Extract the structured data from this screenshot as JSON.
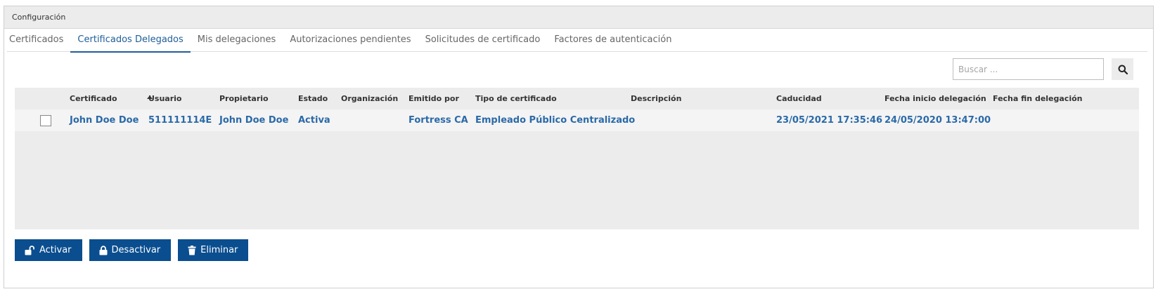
{
  "panel": {
    "title": "Configuración"
  },
  "tabs": [
    {
      "label": "Certificados",
      "active": false
    },
    {
      "label": "Certificados Delegados",
      "active": true
    },
    {
      "label": "Mis delegaciones",
      "active": false
    },
    {
      "label": "Autorizaciones pendientes",
      "active": false
    },
    {
      "label": "Solicitudes de certificado",
      "active": false
    },
    {
      "label": "Factores de autenticación",
      "active": false
    }
  ],
  "search": {
    "placeholder": "Buscar ...",
    "value": "",
    "icon": "search-icon"
  },
  "table": {
    "columns": [
      "Certificado",
      "Usuario",
      "Propietario",
      "Estado",
      "Organización",
      "Emitido por",
      "Tipo de certificado",
      "Descripción",
      "Caducidad",
      "Fecha inicio delegación",
      "Fecha fin delegación"
    ],
    "sorted_column": "Certificado",
    "sort_direction": "ascending",
    "rows": [
      {
        "checked": false,
        "certificado": "John Doe Doe",
        "usuario": "511111114E",
        "propietario": "John Doe Doe",
        "estado": "Activa",
        "organizacion": "",
        "emitido_por": "Fortress CA",
        "tipo": "Empleado Público Centralizado",
        "descripcion": "",
        "caducidad": "23/05/2021 17:35:46",
        "fecha_inicio": "24/05/2020 13:47:00",
        "fecha_fin": ""
      }
    ]
  },
  "actions": {
    "activar": {
      "label": "Activar",
      "icon": "unlock-icon"
    },
    "desactivar": {
      "label": "Desactivar",
      "icon": "lock-icon"
    },
    "eliminar": {
      "label": "Eliminar",
      "icon": "trash-icon"
    }
  },
  "colors": {
    "accent": "#1e5e99",
    "link": "#2b6aa8",
    "button": "#0a4e8f",
    "table_bg": "#ececec"
  }
}
